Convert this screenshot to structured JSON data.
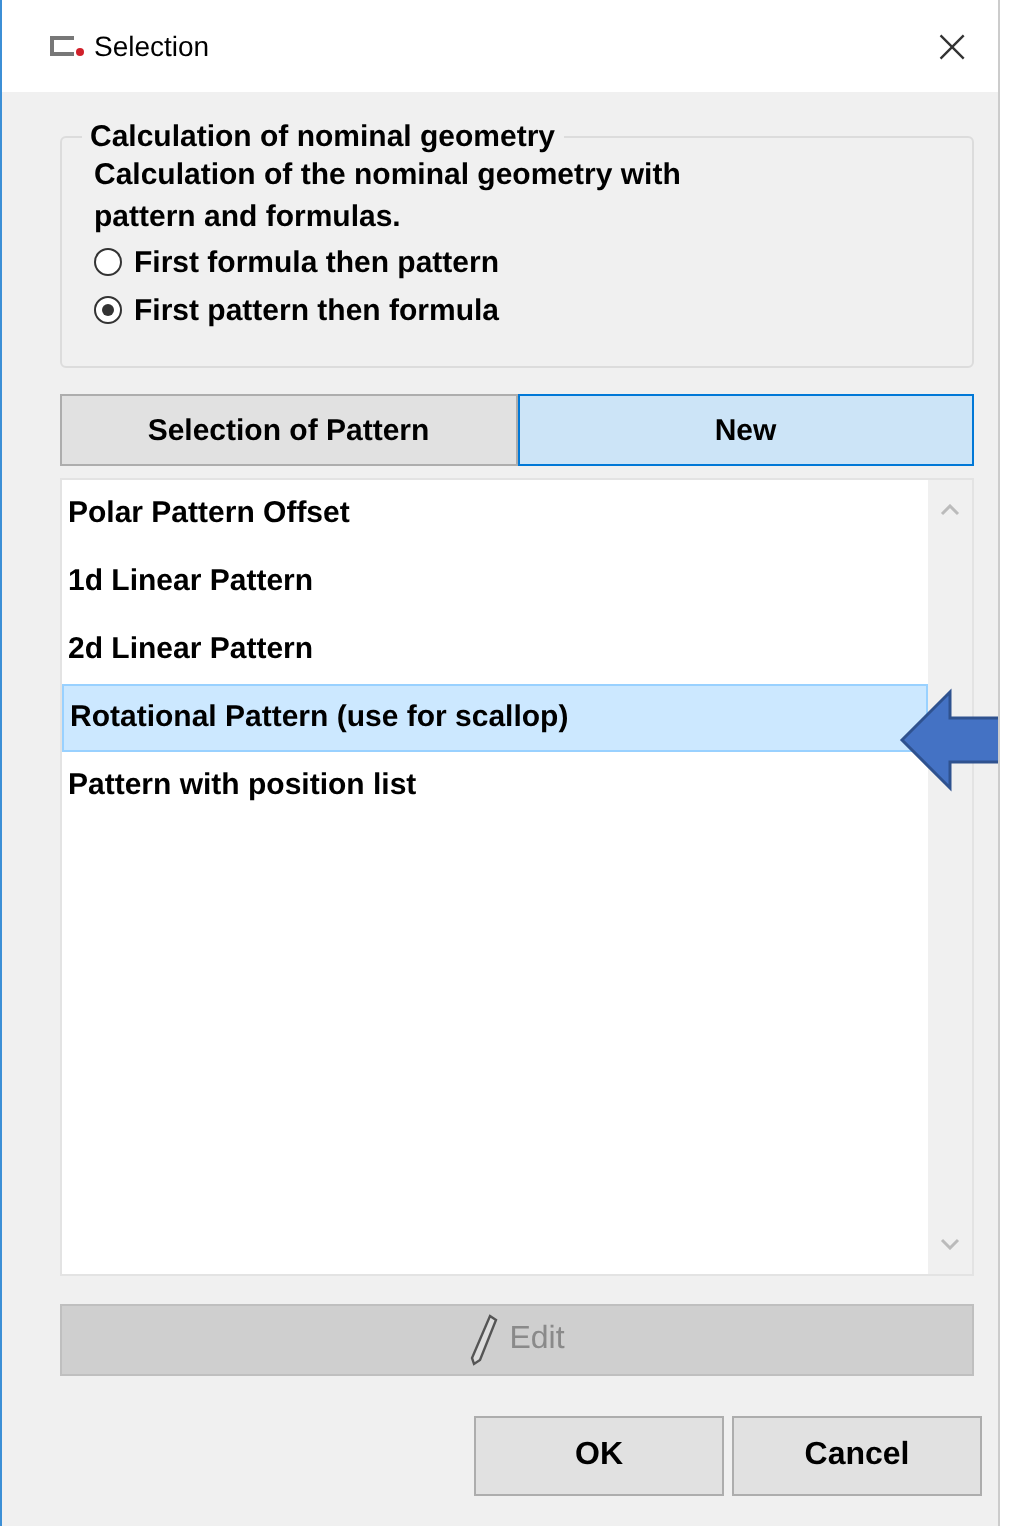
{
  "window": {
    "title": "Selection",
    "close": "×"
  },
  "group": {
    "title": "Calculation of nominal geometry",
    "description": "Calculation of the nominal geometry with pattern and formulas.",
    "options": [
      {
        "label": "First formula then pattern",
        "selected": false
      },
      {
        "label": "First pattern then formula",
        "selected": true
      }
    ]
  },
  "tabs": [
    {
      "label": "Selection of Pattern",
      "selected": false
    },
    {
      "label": "New",
      "selected": true
    }
  ],
  "list": {
    "items": [
      {
        "label": "Polar Pattern Offset",
        "selected": false
      },
      {
        "label": "1d Linear Pattern",
        "selected": false
      },
      {
        "label": "2d Linear Pattern",
        "selected": false
      },
      {
        "label": "Rotational Pattern (use for scallop)",
        "selected": true
      },
      {
        "label": "Pattern with position list",
        "selected": false
      }
    ]
  },
  "edit_button": {
    "label": "Edit",
    "disabled": true
  },
  "buttons": [
    "OK",
    "Cancel"
  ]
}
